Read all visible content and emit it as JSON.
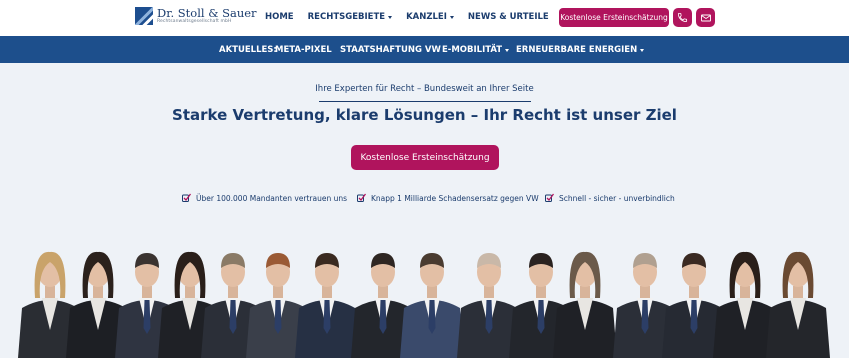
{
  "brand": {
    "name": "Dr. Stoll & Sauer",
    "subtitle": "Rechtsanwaltsgesellschaft mbH"
  },
  "nav": {
    "items": [
      {
        "label": "HOME",
        "dropdown": false
      },
      {
        "label": "RECHTSGEBIETE",
        "dropdown": true
      },
      {
        "label": "KANZLEI",
        "dropdown": true
      },
      {
        "label": "NEWS & URTEILE",
        "dropdown": false
      }
    ],
    "cta_label": "Kostenlose Ersteinschätzung",
    "phone_icon": "phone-icon",
    "mail_icon": "mail-icon"
  },
  "subnav": {
    "label": "AKTUELLES:",
    "links": [
      {
        "label": "META-PIXEL",
        "dropdown": false
      },
      {
        "label": "STAATSHAFTUNG VW",
        "dropdown": false
      },
      {
        "label": "E-MOBILITÄT",
        "dropdown": true
      },
      {
        "label": "ERNEUERBARE ENERGIEN",
        "dropdown": true
      }
    ]
  },
  "hero": {
    "tagline": "Ihre Experten für Recht – Bundesweit an Ihrer Seite",
    "headline": "Starke Vertretung, klare Lösungen – Ihr Recht ist unser Ziel",
    "cta_label": "Kostenlose Ersteinschätzung",
    "usps": [
      "Über 100.000 Mandanten vertrauen uns",
      "Knapp 1 Milliarde Schadensersatz gegen VW",
      "Schnell - sicher - unverbindlich"
    ]
  },
  "colors": {
    "brand_blue": "#1d4f8c",
    "navy_text": "#1b3c6d",
    "accent_magenta": "#b0145d",
    "background": "#eef2f7"
  }
}
